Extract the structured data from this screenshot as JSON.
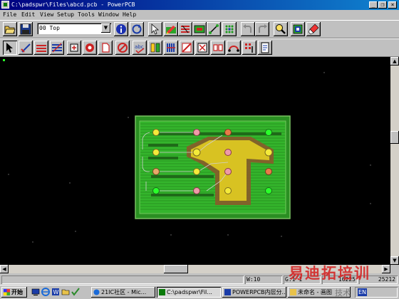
{
  "window": {
    "title": "C:\\padspwr\\Files\\abcd.pcb - PowerPCB",
    "minimize_glyph": "_",
    "restore_glyph": "❐",
    "close_glyph": "×"
  },
  "menu": [
    "File",
    "Edit",
    "View",
    "Setup",
    "Tools",
    "Window",
    "Help"
  ],
  "toolbar1": {
    "layer_combo_value": "00 Top",
    "combo_arrow_glyph": "▼",
    "icons": [
      "open-icon",
      "save-icon",
      "layer-combo",
      "info-icon",
      "redraw-icon",
      "select-icon",
      "design-toolbar-icon",
      "drafting-icon",
      "ecoc-icon",
      "bga-icon",
      "dimension-icon",
      "router-icon",
      "undo-icon",
      "redo-icon",
      "zoom-icon",
      "layers-icon",
      "paint-icon"
    ]
  },
  "toolbar2": {
    "icons": [
      "select-mode-icon",
      "move-icon",
      "route-icon",
      "trace-icon",
      "component-icon",
      "via-icon",
      "split-icon",
      "no-entry-icon",
      "spelling-icon",
      "copper-icon",
      "bus-icon",
      "flood-icon",
      "keepout-icon",
      "pad-icon",
      "jumper-icon",
      "auto-icon",
      "report-icon"
    ]
  },
  "status": {
    "w_field": "W:10",
    "g_field": "G:1  1",
    "x_coord": "16225",
    "y_coord": "25212"
  },
  "taskbar": {
    "start_label": "开始",
    "tasks": [
      {
        "label": "21IC社区 - Mic...",
        "active": false
      },
      {
        "label": "C:\\padspwr\\Fil...",
        "active": true
      },
      {
        "label": "POWERPCB内层分...",
        "active": false
      },
      {
        "label": "未命名 - 画图",
        "active": false
      }
    ],
    "tray_lang": "EN"
  },
  "watermark": {
    "text": "易迪拓培训",
    "sub": "技术"
  },
  "colors": {
    "canvas": "#000000",
    "board_green": "#33b52b",
    "copper_yellow": "#d8c222",
    "trace_brown": "#8a5a2a",
    "titlebar": "#000080"
  }
}
